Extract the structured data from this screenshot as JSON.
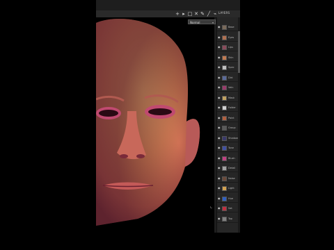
{
  "toolbar": {
    "icons": [
      "add-icon",
      "pointer-icon",
      "square-icon",
      "cross-icon",
      "pen-icon",
      "brush-icon",
      "eyedropper-icon"
    ],
    "panel_title": "LAYERS"
  },
  "canvas": {
    "blend_mode": "Normal"
  },
  "layers": {
    "rows": [
      {
        "name": "Base",
        "color": "#7a6a5a"
      },
      {
        "name": "Eyes",
        "color": "#b07050"
      },
      {
        "name": "Lips",
        "color": "#8a4a5a"
      },
      {
        "name": "Skin",
        "color": "#c07a50"
      },
      {
        "name": "Spec",
        "color": "#c0c0c0"
      },
      {
        "name": "Dirt",
        "color": "#5a6a9a"
      },
      {
        "name": "Vein",
        "color": "#9a3a6a"
      },
      {
        "name": "Mask",
        "color": "#c0a060"
      },
      {
        "name": "Folder",
        "color": "#d0d0d0"
      },
      {
        "name": "Paint",
        "color": "#b06040"
      },
      {
        "name": "Group",
        "color": "#5a5a5a"
      },
      {
        "name": "Shadow",
        "color": "#3a3a6a"
      },
      {
        "name": "Tone",
        "color": "#4050a0"
      },
      {
        "name": "Blush",
        "color": "#c04080"
      },
      {
        "name": "Detail",
        "color": "#a0a0a0"
      },
      {
        "name": "Noise",
        "color": "#6a4a3a"
      },
      {
        "name": "Light",
        "color": "#d0a050"
      },
      {
        "name": "Hue",
        "color": "#3060c0"
      },
      {
        "name": "Sat",
        "color": "#c03040"
      },
      {
        "name": "Top",
        "color": "#808080"
      }
    ]
  }
}
